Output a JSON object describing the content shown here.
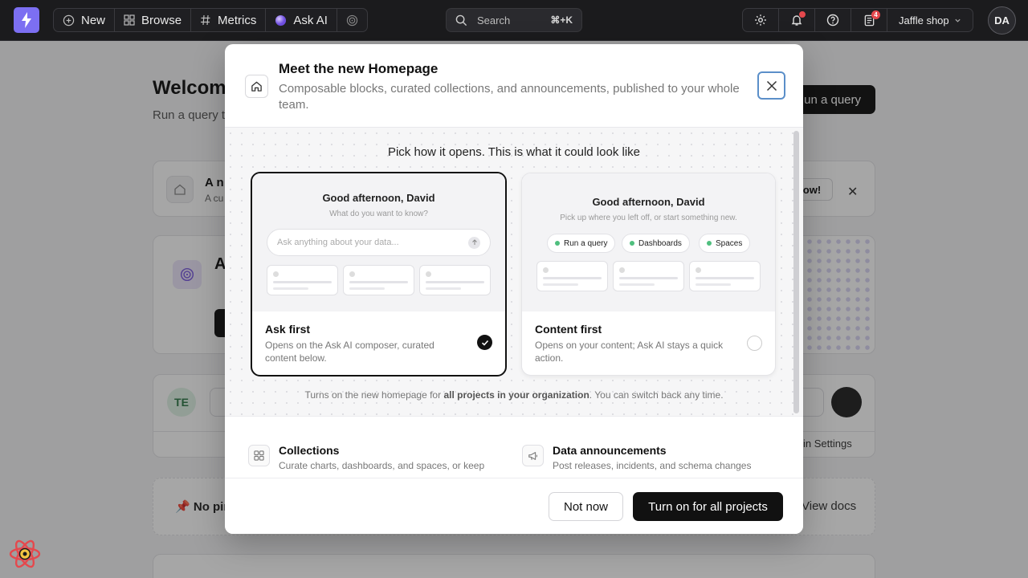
{
  "nav": {
    "new_label": "New",
    "browse_label": "Browse",
    "metrics_label": "Metrics",
    "ask_ai_label": "Ask AI",
    "search_placeholder": "Search",
    "search_shortcut": "⌘+K",
    "reports_badge": "4",
    "project_name": "Jaffle shop",
    "avatar_initials": "DA"
  },
  "background": {
    "title": "Welcom",
    "subtitle": "Run a query to",
    "run_query_label": "un a query",
    "announcement_title": "A n",
    "announcement_sub": "A cu",
    "announcement_btn": "ow!",
    "ask_ai_title": "A",
    "user_initials": "TE",
    "admin_settings": "in Settings",
    "no_pinned": "No pin",
    "view_docs": "View docs"
  },
  "modal": {
    "title": "Meet the new Homepage",
    "subtitle": "Composable blocks, curated collections, and announcements, published to your whole team.",
    "pick_prompt": "Pick how it opens. This is what it could look like",
    "options": [
      {
        "preview_greeting": "Good afternoon, David",
        "preview_hint": "What do you want to know?",
        "preview_input": "Ask anything about your data...",
        "title": "Ask first",
        "description": "Opens on the Ask AI composer, curated content below.",
        "selected": true
      },
      {
        "preview_greeting": "Good afternoon, David",
        "preview_hint": "Pick up where you left off, or start something new.",
        "chips": [
          "Run a query",
          "Dashboards",
          "Spaces"
        ],
        "title": "Content first",
        "description": "Opens on your content; Ask AI stays a quick action.",
        "selected": false
      }
    ],
    "note_prefix": "Turns on the new homepage for ",
    "note_bold": "all projects in your organization",
    "note_suffix": ". You can switch back any time.",
    "features": [
      {
        "title": "Collections",
        "description": "Curate charts, dashboards, and spaces, or keep"
      },
      {
        "title": "Data announcements",
        "description": "Post releases, incidents, and schema changes"
      }
    ],
    "not_now_label": "Not now",
    "turn_on_label": "Turn on for all projects"
  },
  "colors": {
    "brand": "#7c6ff2",
    "topbar": "#1b1b1d",
    "primary_button": "#111111",
    "focus_ring": "#5b8fc9",
    "notification": "#e5484d",
    "chip_dot": "#4fbf7e"
  }
}
